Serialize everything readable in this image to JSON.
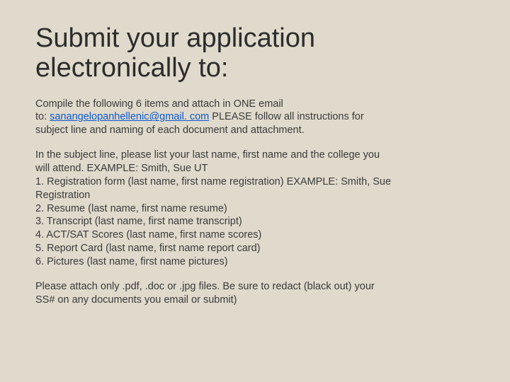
{
  "title": "Submit your application electronically to:",
  "intro": {
    "line1": "Compile the following 6 items and attach in ONE email",
    "line2_prefix": "to: ",
    "email": "sanangelopanhellenic@gmail. com",
    "line2_after": "  PLEASE follow all instructions for",
    "line3": "subject line and naming of each document and attachment."
  },
  "subject_block": {
    "l1": "In the subject line, please list your last name, first name and the college you",
    "l2": "will attend. EXAMPLE: Smith, Sue UT",
    "i1": "1. Registration form (last name, first name registration) EXAMPLE: Smith, Sue",
    "i1b": "Registration",
    "i2": "2. Resume (last name, first name resume)",
    "i3": "3. Transcript (last name, first name transcript)",
    "i4": "4. ACT/SAT Scores (last name, first name scores)",
    "i5": "5. Report Card (last name, first name report card)",
    "i6": "6. Pictures (last name, first name pictures)"
  },
  "closing": {
    "l1": "Please attach only .pdf, .doc or .jpg files.  Be sure to redact (black out) your",
    "l2": "SS# on any documents you email or submit)"
  }
}
